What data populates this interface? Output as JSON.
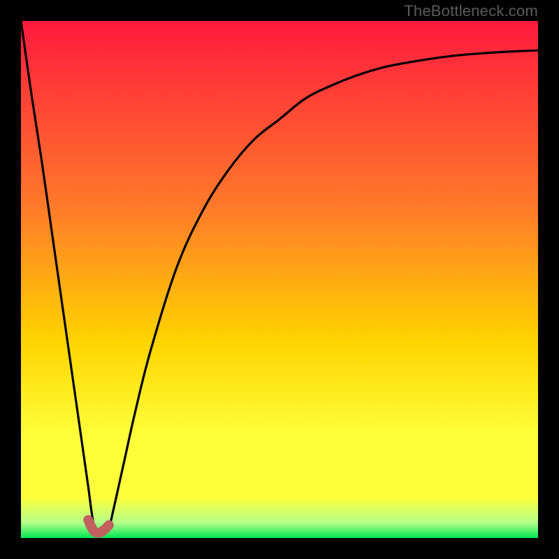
{
  "watermark": "TheBottleneck.com",
  "colors": {
    "gradient_top": "#ff1a3e",
    "gradient_mid1": "#ff7a2a",
    "gradient_mid2": "#ffd400",
    "gradient_yellow": "#ffff3a",
    "gradient_pale_green": "#b6ff8a",
    "gradient_green": "#00e653",
    "curve": "#000000",
    "marker": "#c26060"
  },
  "chart_data": {
    "type": "line",
    "title": "",
    "xlabel": "",
    "ylabel": "",
    "xlim": [
      0,
      100
    ],
    "ylim": [
      0,
      100
    ],
    "series": [
      {
        "name": "bottleneck-curve",
        "x": [
          0,
          2,
          4,
          6,
          8,
          10,
          12,
          13,
          14,
          15,
          16,
          17,
          18,
          20,
          22,
          25,
          30,
          35,
          40,
          45,
          50,
          55,
          60,
          65,
          70,
          75,
          80,
          85,
          90,
          95,
          100
        ],
        "y": [
          100,
          86,
          73,
          59,
          45,
          31,
          17,
          10,
          3,
          1,
          1,
          2,
          6,
          15,
          24,
          36,
          52,
          63,
          71,
          77,
          81,
          85,
          87.5,
          89.5,
          91,
          92,
          92.8,
          93.4,
          93.8,
          94.1,
          94.3
        ]
      }
    ],
    "highlight_segment": {
      "name": "optimal-range-marker",
      "x": [
        13,
        14,
        15,
        16,
        17
      ],
      "y": [
        3.5,
        1.5,
        1,
        1.5,
        2.5
      ]
    }
  }
}
